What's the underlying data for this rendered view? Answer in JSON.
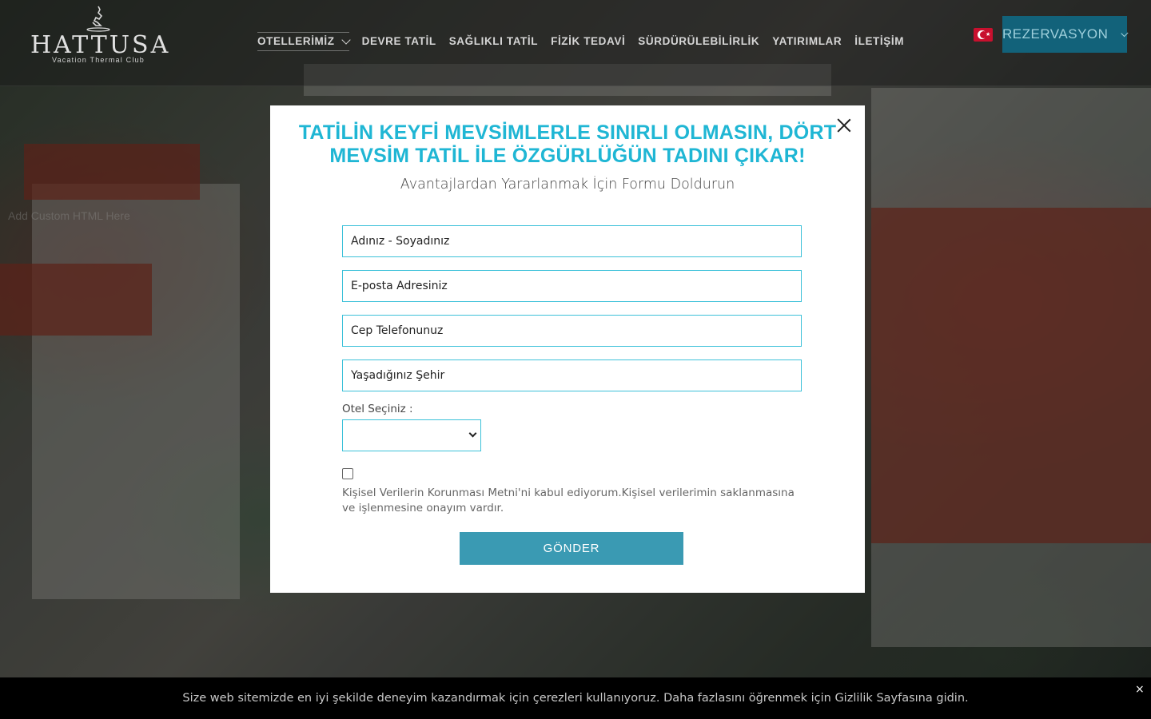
{
  "brand": {
    "name": "HATTUSA",
    "tagline": "Vacation Thermal Club"
  },
  "nav": {
    "items": [
      {
        "label": "OTELLERİMİZ",
        "has_dropdown": true
      },
      {
        "label": "DEVRE TATİL"
      },
      {
        "label": "SAĞLIKLI TATİL"
      },
      {
        "label": "FİZİK TEDAVİ"
      },
      {
        "label": "SÜRDÜRÜLEBİLİRLİK"
      },
      {
        "label": "YATIRIMLAR"
      },
      {
        "label": "İLETİŞİM"
      }
    ],
    "language_flag": "turkey-flag-icon",
    "reservation_label": "REZERVASYON"
  },
  "hero": {
    "ghost_text": "Add Custom HTML Here"
  },
  "modal": {
    "title": "TATİLİN KEYFİ MEVSİMLERLE SINIRLI OLMASIN, DÖRT MEVSİM TATİL İLE ÖZGÜRLÜĞÜN TADINI ÇIKAR!",
    "subtitle": "Avantajlardan Yararlanmak İçin Formu Doldurun",
    "fields": {
      "name_placeholder": "Adınız - Soyadınız",
      "email_placeholder": "E-posta Adresiniz",
      "phone_placeholder": "Cep Telefonunuz",
      "city_placeholder": "Yaşadığınız Şehir"
    },
    "hotel_select_label": "Otel Seçiniz :",
    "hotel_select_value": "",
    "consent_checked": false,
    "consent_text": "Kişisel Verilerin Korunması Metni'ni kabul ediyorum.Kişisel verilerimin saklanmasına ve işlenmesine onayım vardır.",
    "submit_label": "GÖNDER",
    "accent_color": "#1fb6d4"
  },
  "cookie_bar": {
    "text": "Size web sitemizde en iyi şekilde deneyim kazandırmak için çerezleri kullanıyoruz. Daha fazlasını öğrenmek için Gizlilik Sayfasına gidin.",
    "close_label": "×"
  }
}
